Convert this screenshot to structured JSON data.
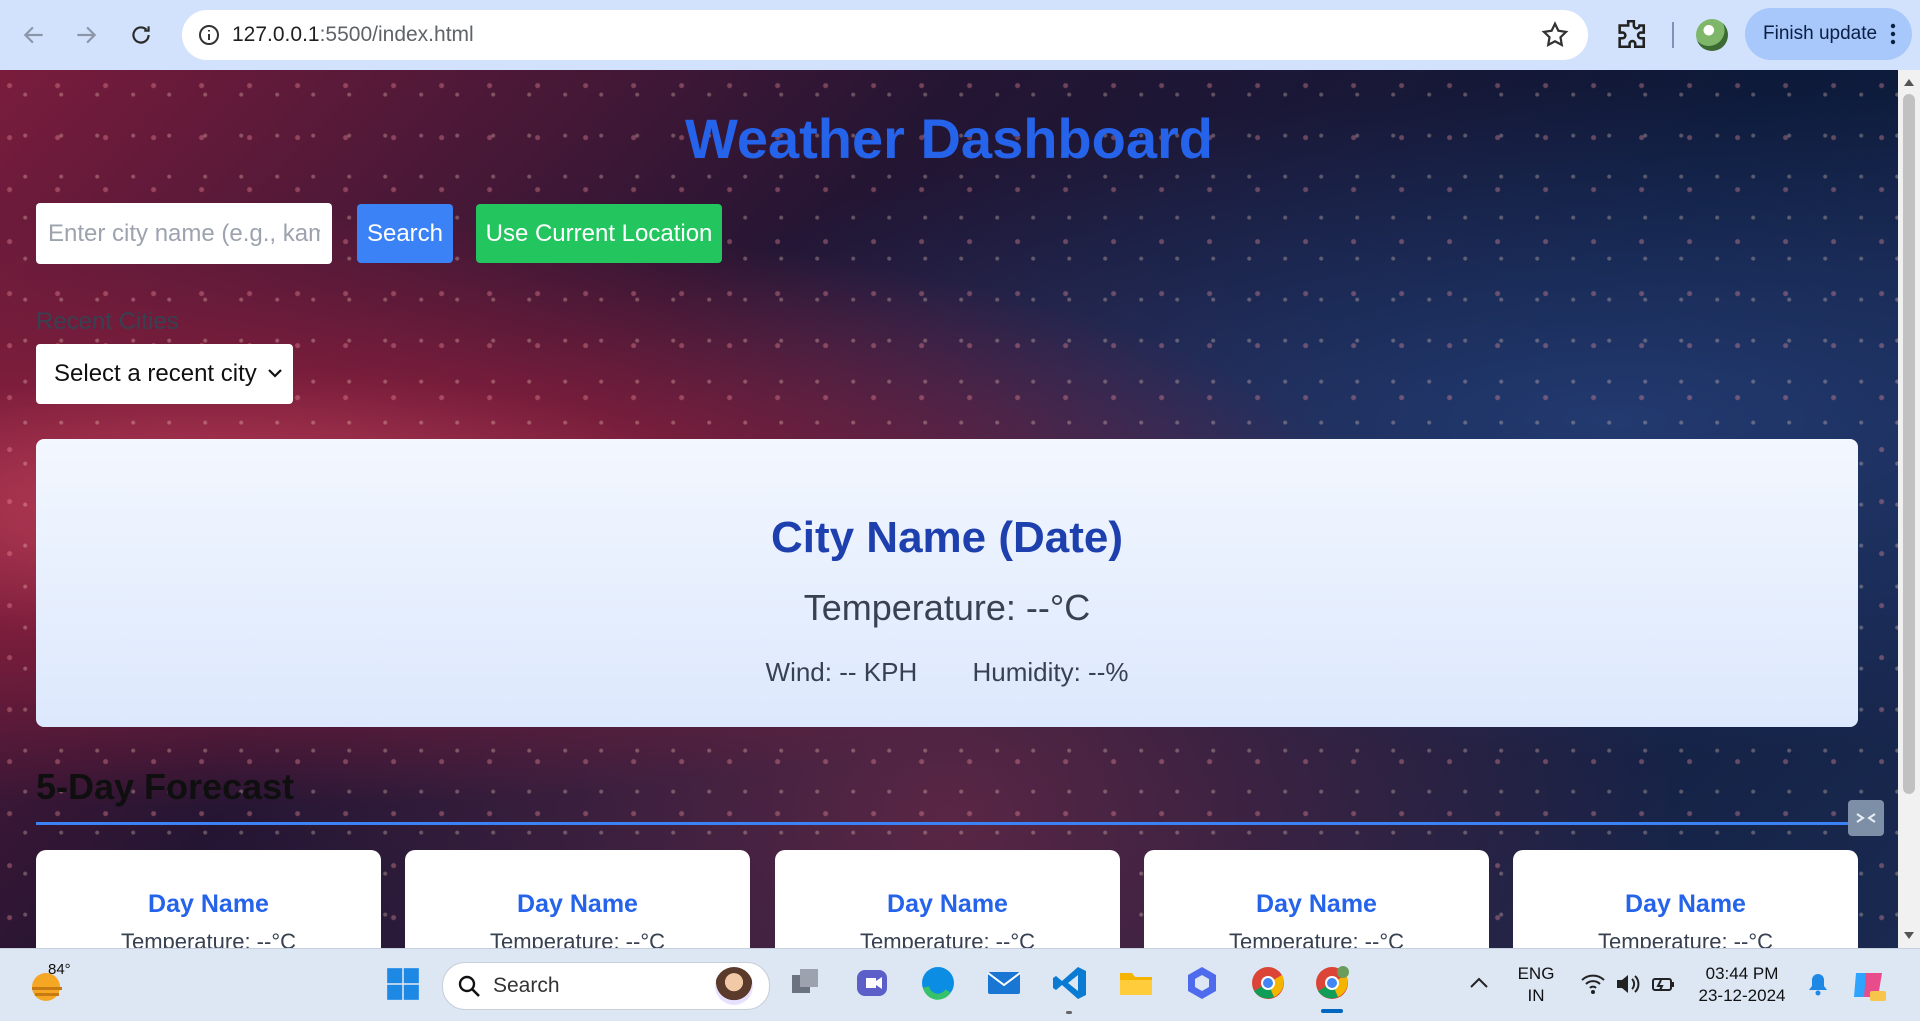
{
  "browser": {
    "url_host": "127.0.0.1",
    "url_path": ":5500/index.html",
    "finish_update_label": "Finish update"
  },
  "page": {
    "title": "Weather Dashboard",
    "search": {
      "placeholder": "Enter city name (e.g., kam",
      "button_label": "Search"
    },
    "location_button_label": "Use Current Location",
    "recent": {
      "label": "Recent Cities",
      "selected": "Select a recent city"
    },
    "current": {
      "city_title": "City Name (Date)",
      "temperature": "Temperature: --°C",
      "wind": "Wind: -- KPH",
      "humidity": "Humidity: --%"
    },
    "forecast": {
      "title": "5-Day Forecast",
      "days": [
        {
          "name": "Day Name",
          "temperature": "Temperature: --°C"
        },
        {
          "name": "Day Name",
          "temperature": "Temperature: --°C"
        },
        {
          "name": "Day Name",
          "temperature": "Temperature: --°C"
        },
        {
          "name": "Day Name",
          "temperature": "Temperature: --°C"
        },
        {
          "name": "Day Name",
          "temperature": "Temperature: --°C"
        }
      ]
    }
  },
  "taskbar": {
    "weather_temp": "84°",
    "search_label": "Search",
    "lang_line1": "ENG",
    "lang_line2": "IN",
    "time": "03:44 PM",
    "date": "23-12-2024",
    "pinned_icons": [
      "task-view-icon",
      "teams-icon",
      "edge-icon",
      "mail-icon",
      "vscode-icon",
      "file-explorer-icon",
      "copilot-app-icon",
      "chrome-icon",
      "chrome-profile-icon"
    ]
  },
  "colors": {
    "title": "#2563eb",
    "search_button": "#3b82f6",
    "location_button": "#22c55e",
    "card_title": "#1e40af",
    "chrome_bar": "#d3e2fc"
  }
}
